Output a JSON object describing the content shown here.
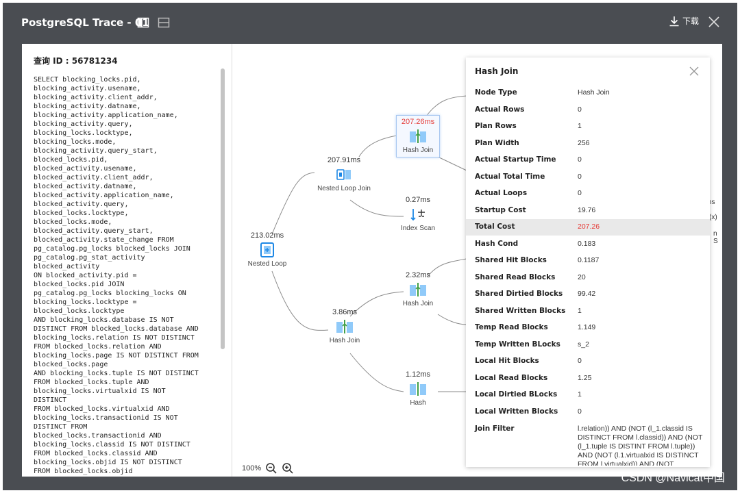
{
  "window": {
    "title": "PostgreSQL Trace - 01",
    "download_label": "下载"
  },
  "query": {
    "id_label": "查询 ID : 56781234",
    "sql": "SELECT blocking_locks.pid,\nblocking_activity.usename,\nblocking_activity.client_addr,\nblocking_activity.datname,\nblocking_activity.application_name,\nblocking_activity.query,\nblocking_locks.locktype,\nblocking_locks.mode,\nblocking_activity.query_start,\nblocked_locks.pid,\nblocked_activity.usename,\nblocked_activity.client_addr,\nblocked_activity.datname,\nblocked_activity.application_name,\nblocked_activity.query,\nblocked_locks.locktype,\nblocked_locks.mode,\nblocked_activity.query_start,\nblocked_activity.state_change FROM\npg_catalog.pg_locks blocked_locks JOIN\npg_catalog.pg_stat_activity\nblocked_activity\nON blocked_activity.pid =\nblocked_locks.pid JOIN\npg_catalog.pg_locks blocking_locks ON\nblocking_locks.locktype =\nblocked_locks.locktype\nAND blocking_locks.database IS NOT\nDISTINCT FROM blocked_locks.database AND\nblocking_locks.relation IS NOT DISTINCT\nFROM blocked_locks.relation AND\nblocking_locks.page IS NOT DISTINCT FROM\nblocked_locks.page\nAND blocking_locks.tuple IS NOT DISTINCT\nFROM blocked_locks.tuple AND\nblocking_locks.virtualxid IS NOT\nDISTINCT\nFROM blocked_locks.virtualxid AND\nblocking_locks.transactionid IS NOT\nDISTINCT FROM\nblocked_locks.transactionid AND\nblocking_locks.classid IS NOT DISTINCT\nFROM blocked_locks.classid AND\nblocking_locks.objid IS NOT DISTINCT\nFROM blocked_locks.objid\nAND blocking_locks.objsubid IS NOT\nDISTINCT FROM blocked_locks.objsubid AND"
  },
  "plan": {
    "nodes": [
      {
        "time": "213.02ms",
        "name": "Nested Loop"
      },
      {
        "time": "207.91ms",
        "name": "Nested Loop Join"
      },
      {
        "time": "207.26ms",
        "name": "Hash Join"
      },
      {
        "time": "0.27ms",
        "name": "Index Scan"
      },
      {
        "time": "3.86ms",
        "name": "Hash Join"
      },
      {
        "time": "2.32ms",
        "name": "Hash Join"
      },
      {
        "time": "1.12ms",
        "name": "Hash"
      }
    ],
    "clipped_labels": [
      "ns",
      "(x)",
      "n S"
    ]
  },
  "zoom": {
    "level": "100%"
  },
  "props": {
    "title": "Hash Join",
    "rows": [
      {
        "key": "Node Type",
        "value": "Hash Join"
      },
      {
        "key": "Actual Rows",
        "value": "0"
      },
      {
        "key": "Plan Rows",
        "value": "1"
      },
      {
        "key": "Plan Width",
        "value": "256"
      },
      {
        "key": "Actual Startup Time",
        "value": "0"
      },
      {
        "key": "Actual Total Time",
        "value": "0"
      },
      {
        "key": "Actual Loops",
        "value": "0"
      },
      {
        "key": "Startup Cost",
        "value": "19.76"
      },
      {
        "key": "Total Cost",
        "value": "207.26"
      },
      {
        "key": "Hash Cond",
        "value": "0.183"
      },
      {
        "key": "Shared Hit Blocks",
        "value": "0.1187"
      },
      {
        "key": "Shared Read Blocks",
        "value": "20"
      },
      {
        "key": "Shared Dirtied Blocks",
        "value": "99.42"
      },
      {
        "key": "Shared Written Blocks",
        "value": "1"
      },
      {
        "key": "Temp Read Blocks",
        "value": "1.149"
      },
      {
        "key": "Temp Written BLocks",
        "value": "s_2"
      },
      {
        "key": "Local Hit Blocks",
        "value": "0"
      },
      {
        "key": "Local Read Blocks",
        "value": "1.25"
      },
      {
        "key": "Local Dirtied BLocks",
        "value": "1"
      },
      {
        "key": "Local Written Blocks",
        "value": "0"
      }
    ],
    "join_filter": {
      "key": "Join Filter",
      "value": "l.relation)) AND (NOT (l_1.classid IS DISTINCT FROM l.classid)) AND (NOT (l_1.tuple IS DISTINT FROM l.tuple)) AND (NOT (l.1.virtualxid IS DISTINCT FROM l.virtualxid)) AND (NOT"
    }
  },
  "watermark": "CSDN @Navicat中国",
  "colors": {
    "window_bg": "#4a4d52",
    "accent_red": "#e53935",
    "icon_blue": "#1e88e5"
  }
}
